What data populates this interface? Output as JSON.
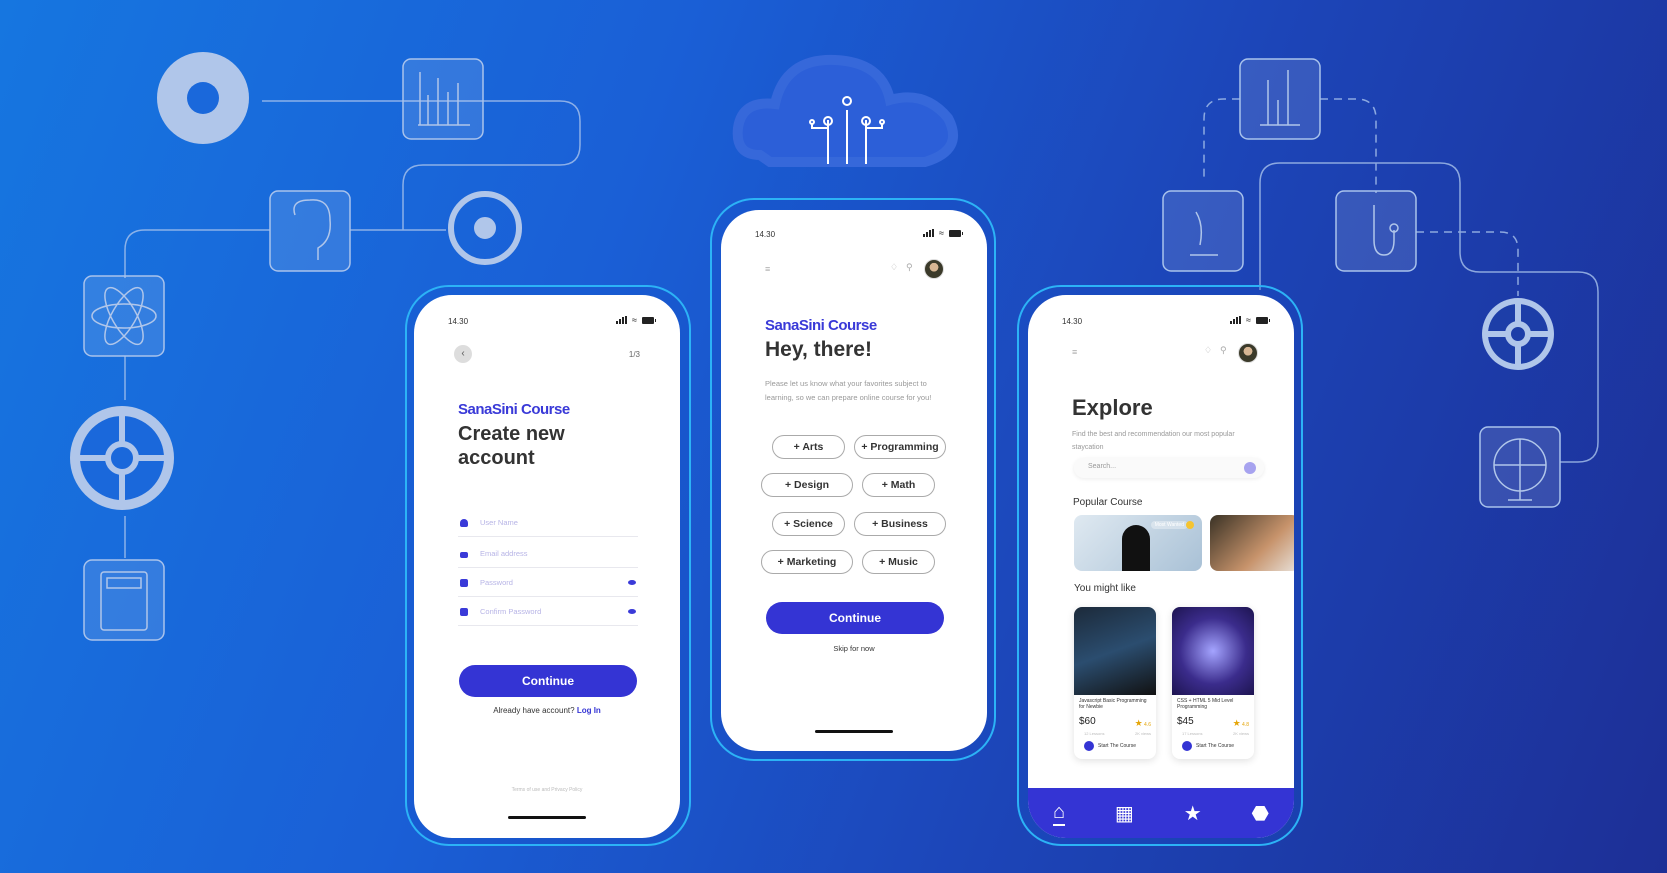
{
  "colors": {
    "accent": "#3434d4",
    "brand_text": "#3a3ad8",
    "outline": "#2cb3f6",
    "bg_start": "#1676e0",
    "bg_end": "#1d2f96"
  },
  "background_icons": [
    "gear-icon",
    "bar-chart-icon",
    "brain-icon",
    "steering-wheel-icon",
    "atom-icon",
    "cog-wheel-icon",
    "calculator-icon",
    "cloud-circuit-icon",
    "chemistry-lab-icon",
    "microscope-icon",
    "stethoscope-icon",
    "cog-wheel-icon",
    "globe-icon"
  ],
  "signup": {
    "status_time": "14.30",
    "step": "1/3",
    "brand": "SanaSini Course",
    "title_line1": "Create new",
    "title_line2": "account",
    "fields": [
      {
        "placeholder": "User Name",
        "icon": "user-icon"
      },
      {
        "placeholder": "Email address",
        "icon": "mail-icon"
      },
      {
        "placeholder": "Password",
        "icon": "lock-icon",
        "toggle": "eye-icon"
      },
      {
        "placeholder": "Confirm Password",
        "icon": "lock-icon",
        "toggle": "eye-icon"
      }
    ],
    "continue_label": "Continue",
    "login_prompt": "Already have account?",
    "login_link": "Log In",
    "footer": "Terms of use and Privacy Policy"
  },
  "interests": {
    "status_time": "14.30",
    "brand": "SanaSini Course",
    "title": "Hey, there!",
    "description": "Please let us know what your favorites subject to learning, so we can prepare online course for you!",
    "chips": [
      "+ Arts",
      "+ Programming",
      "+ Design",
      "+ Math",
      "+ Science",
      "+ Business",
      "+ Marketing",
      "+ Music"
    ],
    "continue_label": "Continue",
    "skip_label": "Skip for now"
  },
  "explore": {
    "status_time": "14.30",
    "title": "Explore",
    "subtitle": "Find the best and recommendation our most popular staycation",
    "search_placeholder": "Search...",
    "popular_heading": "Popular Course",
    "popular_badge": "Most Wanted",
    "might_like_heading": "You might like",
    "courses": [
      {
        "title": "Javascript Basic Programming for Newbie",
        "price": "$60",
        "rating": "4.6",
        "lessons": "12 Lessons",
        "views": "2K views",
        "cta": "Start The Course"
      },
      {
        "title": "CSS + HTML 5 Mid Level Programming",
        "price": "$45",
        "rating": "4.8",
        "lessons": "17 Lessons",
        "views": "2K views",
        "cta": "Start The Course"
      }
    ],
    "nav": [
      "home",
      "apps",
      "favorites",
      "settings"
    ]
  }
}
